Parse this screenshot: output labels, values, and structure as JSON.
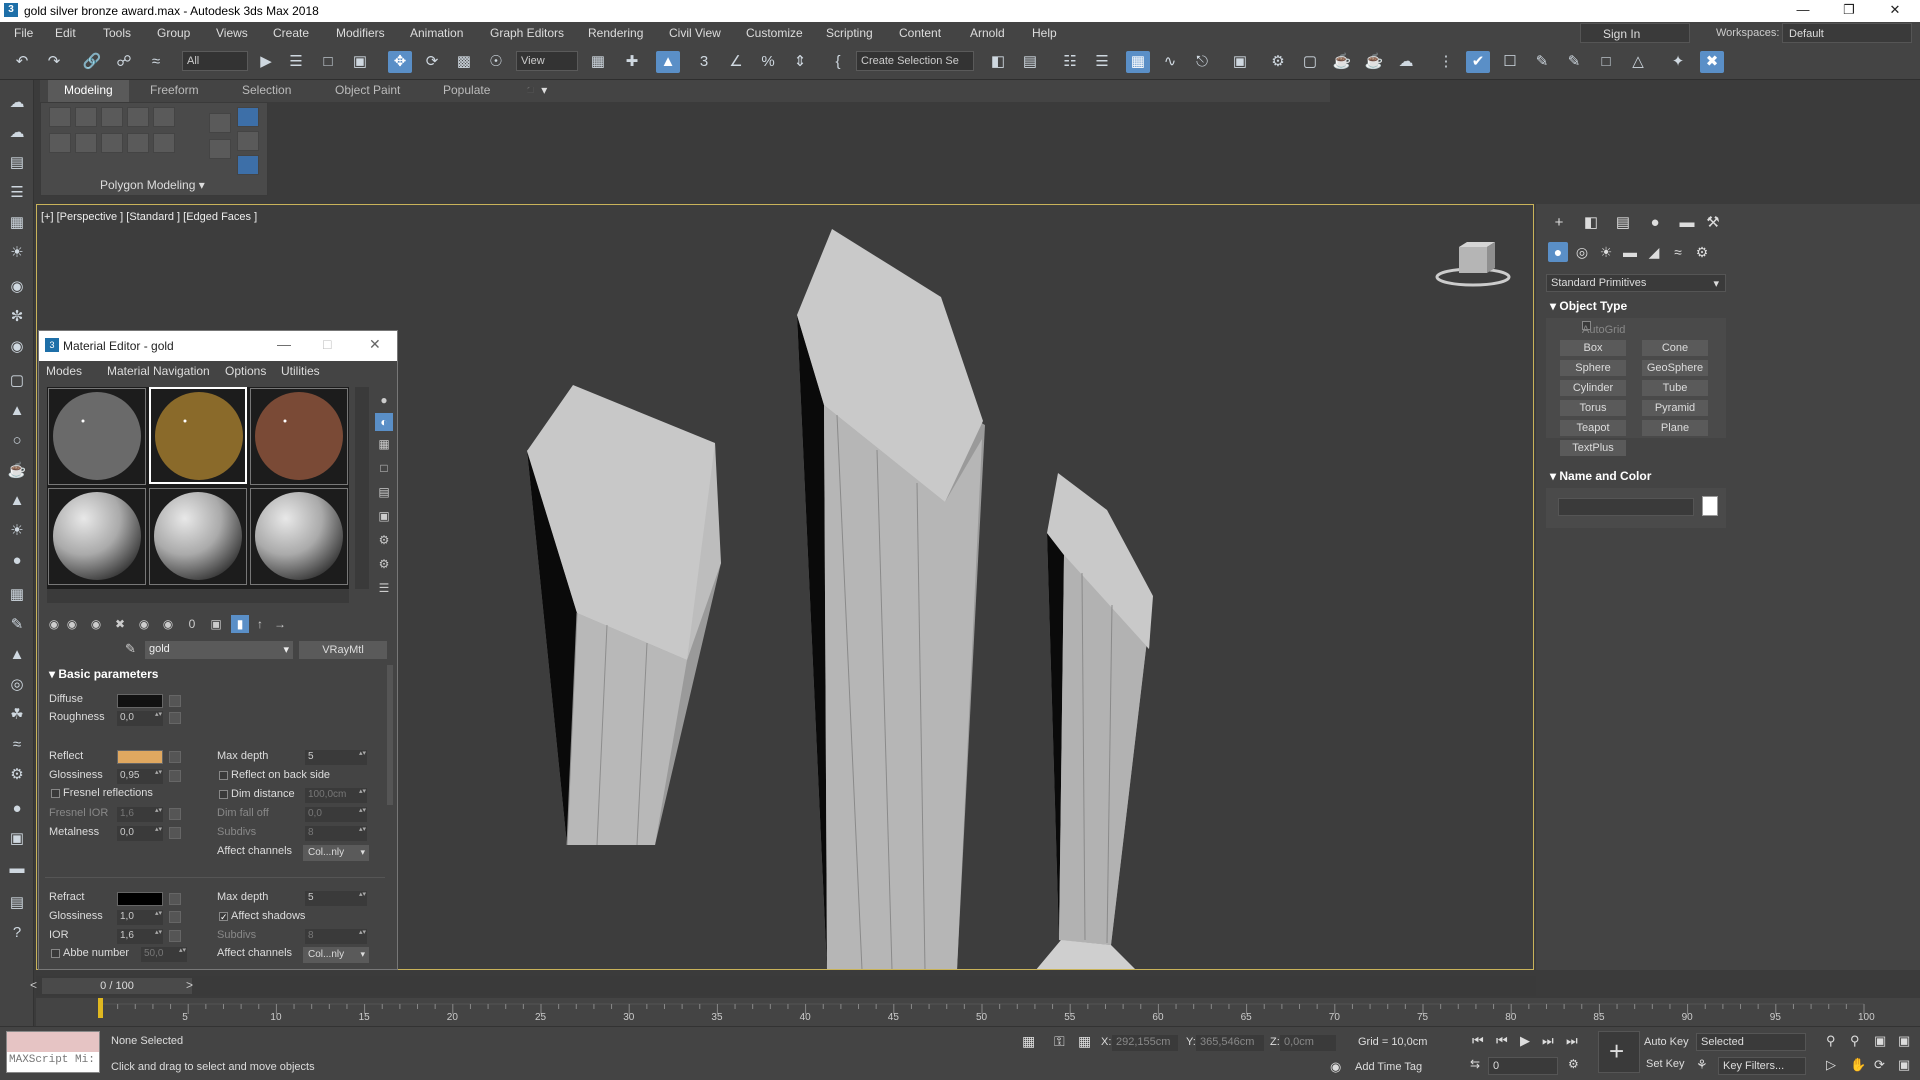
{
  "window": {
    "title": "gold silver bronze award.max - Autodesk 3ds Max 2018",
    "logo": "3"
  },
  "menu": [
    "File",
    "Edit",
    "Tools",
    "Group",
    "Views",
    "Create",
    "Modifiers",
    "Animation",
    "Graph Editors",
    "Rendering",
    "Civil View",
    "Customize",
    "Scripting",
    "Content",
    "Arnold",
    "Help"
  ],
  "account": {
    "signin": "Sign In",
    "workspaces_label": "Workspaces:",
    "workspace": "Default"
  },
  "toolbar": {
    "filter": "All",
    "refcoord": "View",
    "selection_set": "Create Selection Se"
  },
  "ribbon": {
    "tabs": [
      "Modeling",
      "Freeform",
      "Selection",
      "Object Paint",
      "Populate"
    ],
    "active_tab": "Modeling",
    "panel_label": "Polygon Modeling"
  },
  "viewport": {
    "label": "[+] [Perspective ] [Standard ] [Edged Faces ]"
  },
  "command_panel": {
    "category": "Standard Primitives",
    "object_type_title": "Object Type",
    "autogrid": "AutoGrid",
    "buttons": [
      "Box",
      "Cone",
      "Sphere",
      "GeoSphere",
      "Cylinder",
      "Tube",
      "Torus",
      "Pyramid",
      "Teapot",
      "Plane",
      "TextPlus"
    ],
    "name_color_title": "Name and Color",
    "object_color": "#ffffff"
  },
  "material_editor": {
    "title": "Material Editor - gold",
    "menu": [
      "Modes",
      "Material",
      "Navigation",
      "Options",
      "Utilities"
    ],
    "material_name": "gold",
    "material_type": "VRayMtl",
    "section": "Basic parameters",
    "diffuse": {
      "label": "Diffuse",
      "color": "#111111"
    },
    "roughness": {
      "label": "Roughness",
      "value": "0,0"
    },
    "reflect": {
      "label": "Reflect",
      "color": "#e0a860"
    },
    "refl_glossiness": {
      "label": "Glossiness",
      "value": "0,95"
    },
    "fresnel": "Fresnel reflections",
    "fresnel_ior": {
      "label": "Fresnel IOR",
      "value": "1,6"
    },
    "metalness": {
      "label": "Metalness",
      "value": "0,0"
    },
    "refl_max_depth": {
      "label": "Max depth",
      "value": "5"
    },
    "reflect_back": "Reflect on back side",
    "dim_distance": {
      "label": "Dim distance",
      "value": "100,0cm"
    },
    "dim_falloff": {
      "label": "Dim fall off",
      "value": "0,0"
    },
    "refl_subdivs": {
      "label": "Subdivs",
      "value": "8"
    },
    "refl_affect": {
      "label": "Affect channels",
      "value": "Col...nly"
    },
    "refract": {
      "label": "Refract",
      "color": "#000000"
    },
    "refr_glossiness": {
      "label": "Glossiness",
      "value": "1,0"
    },
    "ior": {
      "label": "IOR",
      "value": "1,6"
    },
    "abbe": {
      "label": "Abbe number",
      "value": "50,0"
    },
    "refr_max_depth": {
      "label": "Max depth",
      "value": "5"
    },
    "affect_shadows": "Affect shadows",
    "refr_subdivs": {
      "label": "Subdivs",
      "value": "8"
    },
    "refr_affect": {
      "label": "Affect channels",
      "value": "Col...nly"
    },
    "slots": [
      {
        "color": "#6a6a6a",
        "type": "flat"
      },
      {
        "color": "#8a6a2a",
        "type": "flat"
      },
      {
        "color": "#7a4a36",
        "type": "flat"
      },
      {
        "color": "#aaaaaa",
        "type": "sphere"
      },
      {
        "color": "#aaaaaa",
        "type": "sphere"
      },
      {
        "color": "#aaaaaa",
        "type": "sphere"
      }
    ]
  },
  "time": {
    "slider": "0 / 100",
    "ticks": [
      "5",
      "10",
      "15",
      "20",
      "25",
      "30",
      "35",
      "40",
      "45",
      "50",
      "55",
      "60",
      "65",
      "70",
      "75",
      "80",
      "85",
      "90",
      "95",
      "100"
    ]
  },
  "status": {
    "maxscript": "MAXScript Mi:",
    "selection": "None Selected",
    "prompt": "Click and drag to select and move objects",
    "x_label": "X:",
    "x": "292,155cm",
    "y_label": "Y:",
    "y": "365,546cm",
    "z_label": "Z:",
    "z": "0,0cm",
    "grid": "Grid = 10,0cm",
    "add_time_tag": "Add Time Tag",
    "auto_key": "Auto Key",
    "set_key": "Set Key",
    "key_mode": "Selected",
    "key_filters": "Key Filters...",
    "frame": "0"
  }
}
